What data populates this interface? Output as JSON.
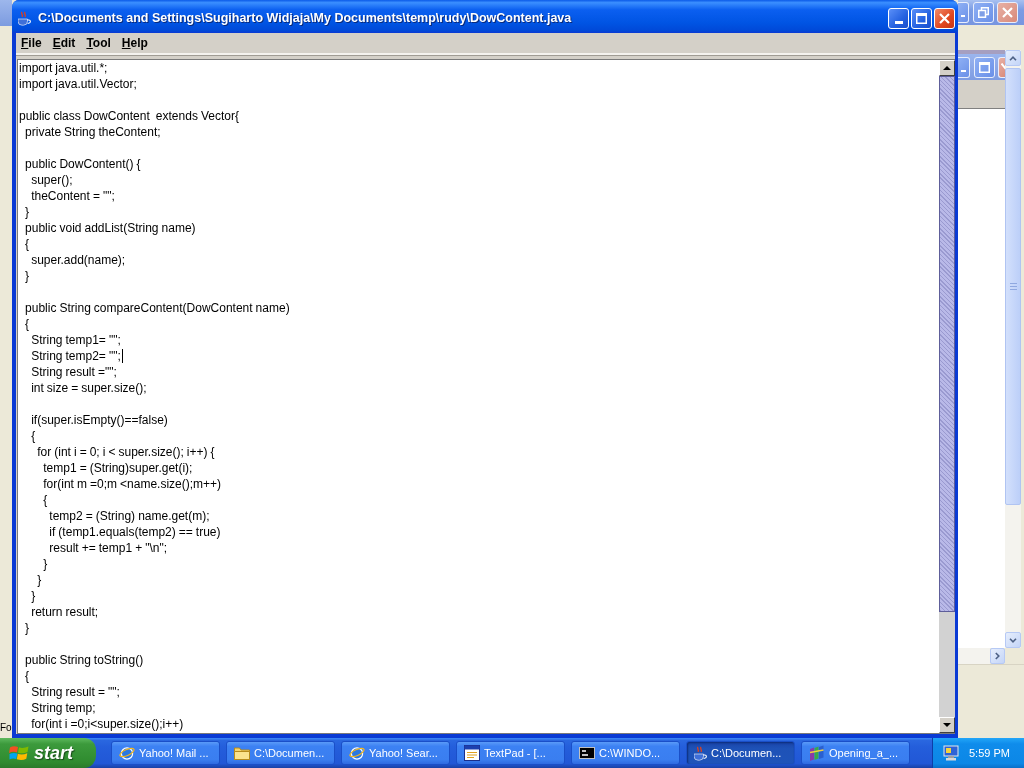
{
  "background_window_left": {
    "text": "Fo"
  },
  "window": {
    "title": "C:\\Documents and Settings\\Sugiharto Widjaja\\My Documents\\temp\\rudy\\DowContent.java",
    "menu": [
      "File",
      "Edit",
      "Tool",
      "Help"
    ],
    "editor": {
      "lines": [
        {
          "text": "import java.util.*;",
          "cursor": false
        },
        {
          "text": "import java.util.Vector;",
          "cursor": false
        },
        {
          "cursor": false
        },
        {
          "text": "public class DowContent  extends Vector{",
          "cursor": false
        },
        {
          "text": "  private String theContent;",
          "cursor": false
        },
        {
          "cursor": false
        },
        {
          "text": "  public DowContent() {",
          "cursor": false
        },
        {
          "text": "    super();",
          "cursor": false
        },
        {
          "text": "    theContent = \"\";",
          "cursor": false
        },
        {
          "text": "  }",
          "cursor": false
        },
        {
          "text": "  public void addList(String name)",
          "cursor": false
        },
        {
          "text": "  {",
          "cursor": false
        },
        {
          "text": "    super.add(name);",
          "cursor": false
        },
        {
          "text": "  }",
          "cursor": false
        },
        {
          "cursor": false
        },
        {
          "text": "  public String compareContent(DowContent name)",
          "cursor": false
        },
        {
          "text": "  {",
          "cursor": false
        },
        {
          "text": "    String temp1= \"\";",
          "cursor": false
        },
        {
          "text": "    String temp2= \"\";",
          "cursor": true
        },
        {
          "text": "    String result =\"\";",
          "cursor": false
        },
        {
          "text": "    int size = super.size();",
          "cursor": false
        },
        {
          "cursor": false
        },
        {
          "text": "    if(super.isEmpty()==false)",
          "cursor": false
        },
        {
          "text": "    {",
          "cursor": false
        },
        {
          "text": "      for (int i = 0; i < super.size(); i++) {",
          "cursor": false
        },
        {
          "text": "        temp1 = (String)super.get(i);",
          "cursor": false
        },
        {
          "text": "        for(int m =0;m <name.size();m++)",
          "cursor": false
        },
        {
          "text": "        {",
          "cursor": false
        },
        {
          "text": "          temp2 = (String) name.get(m);",
          "cursor": false
        },
        {
          "text": "          if (temp1.equals(temp2) == true)",
          "cursor": false
        },
        {
          "text": "          result += temp1 + \"\\n\";",
          "cursor": false
        },
        {
          "text": "        }",
          "cursor": false
        },
        {
          "text": "      }",
          "cursor": false
        },
        {
          "text": "    }",
          "cursor": false
        },
        {
          "text": "    return result;",
          "cursor": false
        },
        {
          "text": "  }",
          "cursor": false
        },
        {
          "cursor": false
        },
        {
          "text": "  public String toString()",
          "cursor": false
        },
        {
          "text": "  {",
          "cursor": false
        },
        {
          "text": "    String result = \"\";",
          "cursor": false
        },
        {
          "text": "    String temp;",
          "cursor": false
        },
        {
          "text": "    for(int i =0;i<super.size();i++)",
          "cursor": false
        }
      ]
    }
  },
  "taskbar": {
    "start_label": "start",
    "tasks": [
      {
        "label": "Yahoo! Mail ...",
        "kind": "browser",
        "selected": false
      },
      {
        "label": "C:\\Documen...",
        "kind": "folder",
        "selected": false
      },
      {
        "label": "Yahoo! Sear...",
        "kind": "browser",
        "selected": false
      },
      {
        "label": "TextPad - [...",
        "kind": "editor",
        "selected": false
      },
      {
        "label": "C:\\WINDO...",
        "kind": "console",
        "selected": false
      },
      {
        "label": "C:\\Documen...",
        "kind": "java",
        "selected": true
      },
      {
        "label": "Opening_a_...",
        "kind": "archive",
        "selected": false
      }
    ],
    "clock": "5:59 PM"
  }
}
